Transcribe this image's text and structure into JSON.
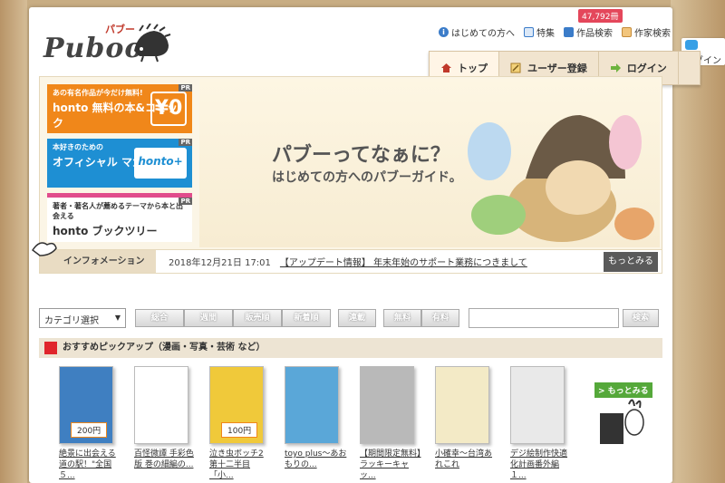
{
  "header": {
    "logo_text": "Puboo",
    "logo_kana": "パブー",
    "links": [
      {
        "label": "はじめての方へ",
        "icon": "info-icon"
      },
      {
        "label": "特集",
        "icon": "book-icon"
      },
      {
        "label": "作品検索",
        "icon": "document-icon"
      },
      {
        "label": "作家検索",
        "icon": "face-icon"
      }
    ],
    "work_count": "47,792冊"
  },
  "nav": [
    {
      "label": "トップ",
      "icon": "home-icon"
    },
    {
      "label": "ユーザー登録",
      "icon": "pencil-icon"
    },
    {
      "label": "ログイン",
      "icon": "arrow-right-icon"
    }
  ],
  "twitter": {
    "label": "ログイン"
  },
  "banners": [
    {
      "small": "あの有名作品が今だけ無料!",
      "big": "honto 無料の本&コミック",
      "badge": "¥0",
      "pr": "PR"
    },
    {
      "small": "本好きのための",
      "big": "オフィシャル マガジン",
      "badge": "honto+",
      "pr": "PR"
    },
    {
      "small": "著者・著名人が薦めるテーマから本と出会える",
      "big": "honto ブックツリー",
      "pr": "PR"
    }
  ],
  "hero": {
    "title": "パブーってなぁに？",
    "subtitle": "はじめての方へのパブーガイド。"
  },
  "info": {
    "label": "インフォメーション",
    "date": "2018年12月21日 17:01",
    "text": "【アップデート情報】 年末年始のサポート業務につきまして",
    "more": "もっとみる"
  },
  "filters": {
    "category": "カテゴリ選択",
    "group1": [
      "総合",
      "週間",
      "販売順",
      "新着順"
    ],
    "group2": [
      "連載"
    ],
    "group3": [
      "無料",
      "有料"
    ],
    "search_label": "検索"
  },
  "recommend": {
    "heading": "おすすめピックアップ（漫画・写真・芸術 など）",
    "more": "> もっとみる",
    "books": [
      {
        "title": "絶景に出会える道の駅！\"全国５...",
        "price": "200円",
        "color": "#3f7fc1"
      },
      {
        "title": "百怪微譚 手彩色版 巻の細編の...",
        "price": "",
        "color": "#ffffff"
      },
      {
        "title": "泣き虫ボッチ2 第十二半目「小...",
        "price": "100円",
        "color": "#f0c93a"
      },
      {
        "title": "toyo plus〜あおもりの...",
        "price": "",
        "color": "#5aa7d8"
      },
      {
        "title": "【期間限定無料】ラッキーキャッ...",
        "price": "",
        "color": "#b9b9b9"
      },
      {
        "title": "小確幸〜台湾あれこれ",
        "price": "",
        "color": "#f3eac6"
      },
      {
        "title": "デジ絵制作快適化計画番外編１...",
        "price": "",
        "color": "#e9e9e9"
      }
    ]
  }
}
